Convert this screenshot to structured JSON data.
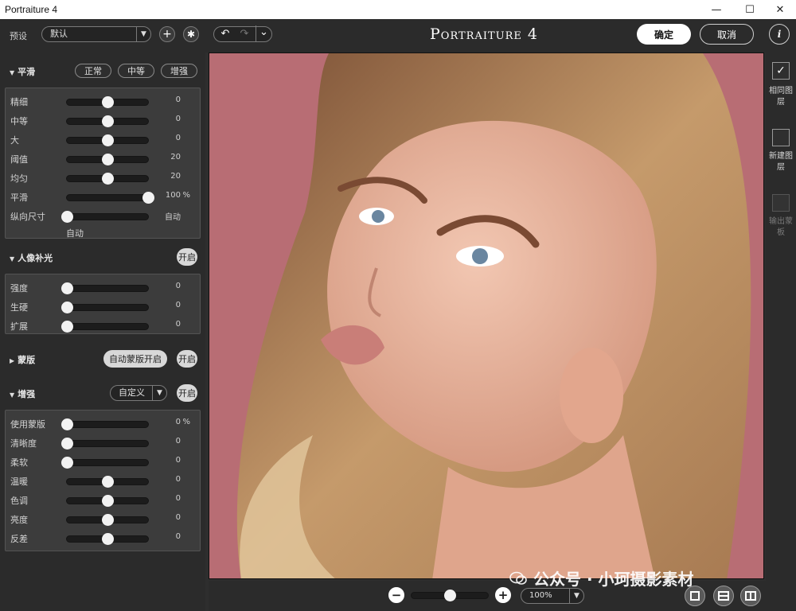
{
  "window": {
    "title": "Portraiture 4",
    "minimize": "—",
    "maximize": "☐",
    "close": "✕"
  },
  "toolbar": {
    "preset_label": "预设",
    "preset_value": "默认",
    "add_glyph": "+",
    "gear_glyph": "✱",
    "undo_glyph": "↶",
    "redo_glyph": "↷",
    "history_glyph": "⌄",
    "brand": "Portraiture 4",
    "ok_label": "确定",
    "cancel_label": "取消",
    "info_glyph": "i"
  },
  "smooth": {
    "title": "平滑",
    "modes": [
      "正常",
      "中等",
      "增强"
    ],
    "sliders": [
      {
        "label": "精细",
        "value": "0",
        "unit": "",
        "level": 0.5
      },
      {
        "label": "中等",
        "value": "0",
        "unit": "",
        "level": 0.5
      },
      {
        "label": "大",
        "value": "0",
        "unit": "",
        "level": 0.5
      },
      {
        "label": "阈值",
        "value": "20",
        "unit": "",
        "level": 0.5
      },
      {
        "label": "均匀",
        "value": "20",
        "unit": "",
        "level": 0.5
      },
      {
        "label": "平滑",
        "value": "100",
        "unit": "%",
        "level": 1.0
      },
      {
        "label": "纵向尺寸",
        "value": "自动",
        "unit": "",
        "level": 0.0
      }
    ],
    "auto_label": "自动"
  },
  "portrait_light": {
    "title": "人像补光",
    "toggle": "开启",
    "sliders": [
      {
        "label": "强度",
        "value": "0",
        "level": 0.0
      },
      {
        "label": "生硬",
        "value": "0",
        "level": 0.0
      },
      {
        "label": "扩展",
        "value": "0",
        "level": 0.0
      }
    ]
  },
  "mask": {
    "title": "蒙版",
    "auto_mask": "自动蒙版开启",
    "toggle": "开启"
  },
  "enhance": {
    "title": "增强",
    "mode": "自定义",
    "toggle": "开启",
    "sliders": [
      {
        "label": "使用蒙版",
        "value": "0",
        "unit": "%",
        "level": 0.0
      },
      {
        "label": "清晰度",
        "value": "0",
        "unit": "",
        "level": 0.0
      },
      {
        "label": "柔软",
        "value": "0",
        "unit": "",
        "level": 0.0
      },
      {
        "label": "温暖",
        "value": "0",
        "unit": "",
        "level": 0.5
      },
      {
        "label": "色调",
        "value": "0",
        "unit": "",
        "level": 0.5
      },
      {
        "label": "亮度",
        "value": "0",
        "unit": "",
        "level": 0.5
      },
      {
        "label": "反差",
        "value": "0",
        "unit": "",
        "level": 0.5
      }
    ]
  },
  "right_panel": {
    "same_layer": "相同图层",
    "new_layer": "新建图层",
    "output_mask": "输出蒙板",
    "check_glyph": "✓"
  },
  "bottom": {
    "zoom_value": "100%",
    "zoom_level": 0.5,
    "minus_glyph": "−",
    "plus_glyph": "+",
    "watermark": "公众号 · 小珂摄影素材"
  },
  "colors": {
    "background": "#b86d74",
    "hair": "#c49a6c",
    "skin": "#e9b7a0",
    "accent": "#ffffff"
  }
}
